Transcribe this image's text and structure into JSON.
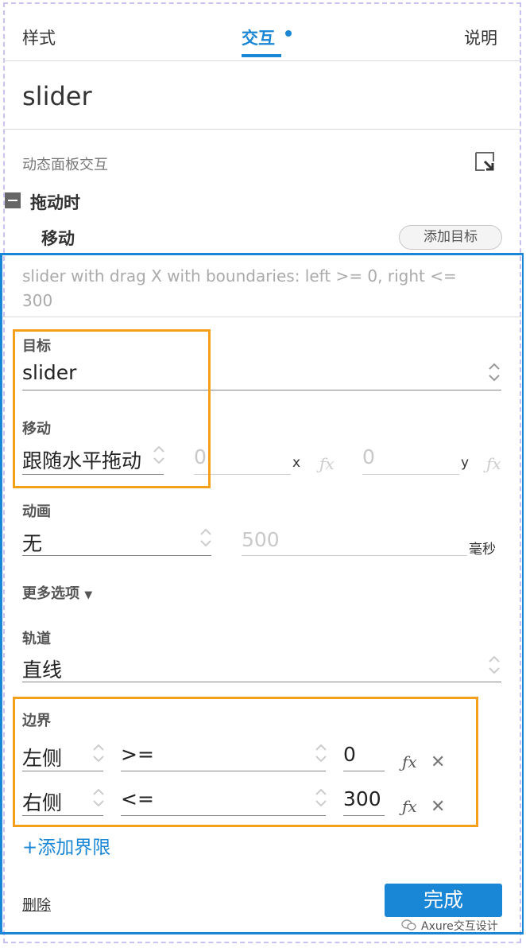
{
  "tabs": [
    {
      "label": "样式"
    },
    {
      "label": "交互"
    },
    {
      "label": "说明"
    }
  ],
  "widget_name": "slider",
  "section": {
    "label": "动态面板交互"
  },
  "event": {
    "label": "拖动时"
  },
  "action": {
    "label": "移动",
    "add_target_label": "添加目标"
  },
  "description": "slider with drag X  with boundaries: left >= 0, right <= 300",
  "target": {
    "label": "目标",
    "value": "slider"
  },
  "move": {
    "label": "移动",
    "value": "跟随水平拖动",
    "x_value": "0",
    "x_label": "x",
    "y_value": "0",
    "y_label": "y"
  },
  "animation": {
    "label": "动画",
    "value": "无",
    "duration": "500",
    "unit": "毫秒"
  },
  "more_options": {
    "label": "更多选项",
    "arrow": "▼"
  },
  "track": {
    "label": "轨道",
    "value": "直线"
  },
  "boundaries": {
    "label": "边界",
    "rows": [
      {
        "side": "左侧",
        "operator": ">=",
        "value": "0"
      },
      {
        "side": "右侧",
        "operator": "<=",
        "value": "300"
      }
    ],
    "add_label": "+添加界限"
  },
  "footer": {
    "delete_label": "删除",
    "done_label": "完成"
  },
  "watermark": "Axure交互设计",
  "colors": {
    "accent": "#1a86d6",
    "highlight": "#f5a01b",
    "frame": "#c9c2f0"
  },
  "icons": {
    "fx": "ƒx",
    "close": "✕"
  }
}
